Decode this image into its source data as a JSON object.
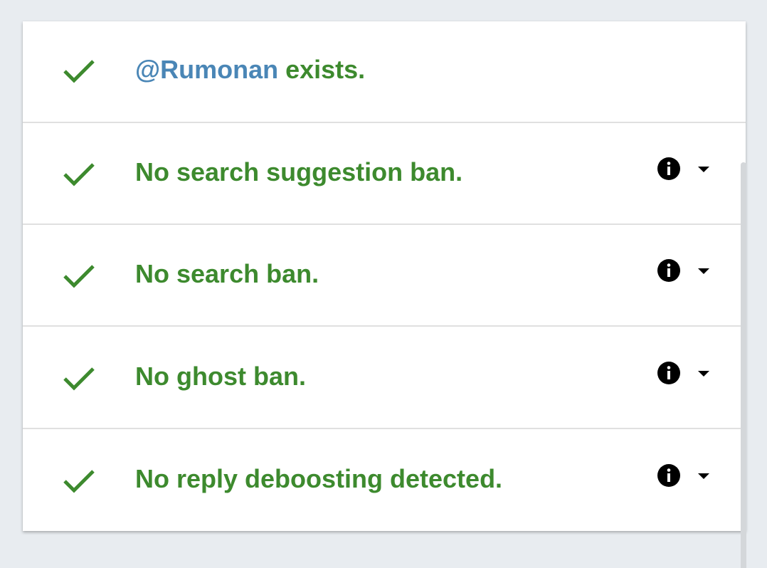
{
  "colors": {
    "success_green": "#3d8a2e",
    "handle_blue": "#4a86b6",
    "background": "#e8ecf0"
  },
  "results": [
    {
      "handle": "@Rumonan",
      "label": " exists.",
      "icon": "check-icon",
      "has_details": false
    },
    {
      "label": "No search suggestion ban.",
      "icon": "check-icon",
      "has_details": true
    },
    {
      "label": "No search ban.",
      "icon": "check-icon",
      "has_details": true
    },
    {
      "label": "No ghost ban.",
      "icon": "check-icon",
      "has_details": true
    },
    {
      "label": "No reply deboosting detected.",
      "icon": "check-icon",
      "has_details": true
    }
  ]
}
